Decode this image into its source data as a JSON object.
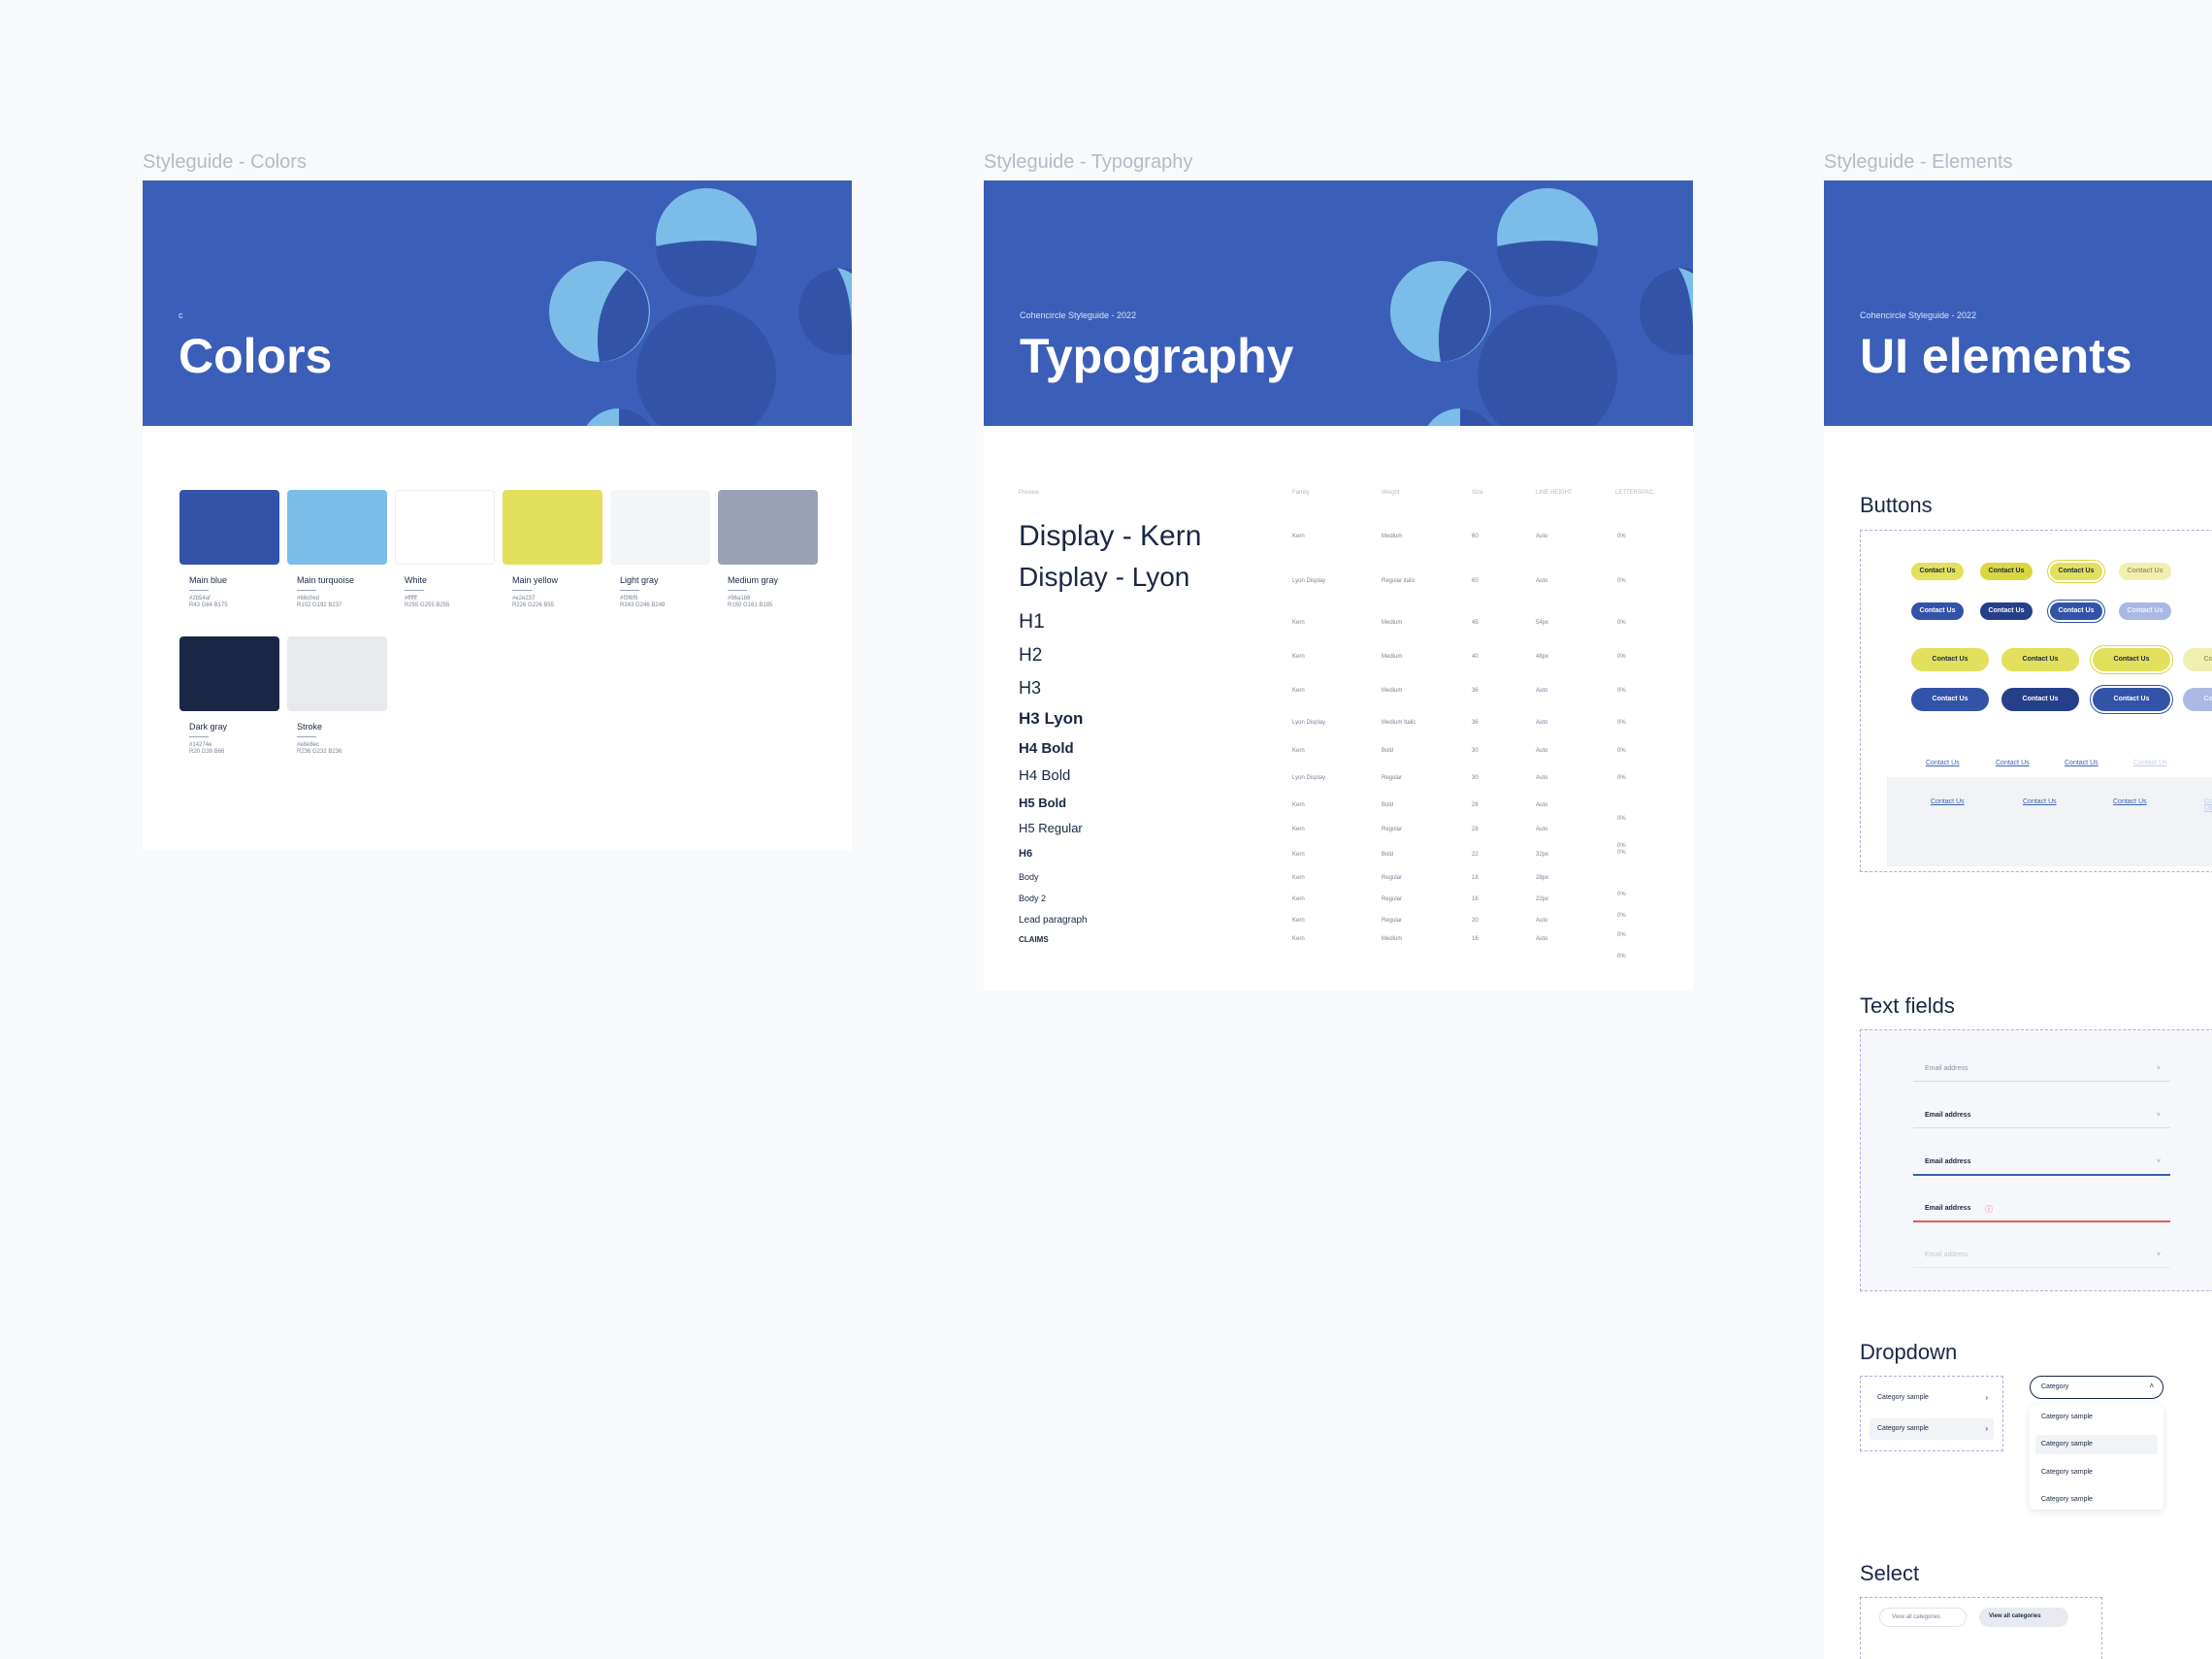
{
  "frames": {
    "colors_label": "Styleguide - Colors",
    "typography_label": "Styleguide - Typography",
    "elements_label": "Styleguide - Elements"
  },
  "colors": {
    "hero_sub": "c",
    "hero_title": "Colors",
    "swatches": [
      {
        "name": "Main blue",
        "hex": "#2b54af",
        "rgb": "R43 G84 B175",
        "color": "#3353a8"
      },
      {
        "name": "Main turquoise",
        "hex": "#66c0ed",
        "rgb": "R102 G192 B237",
        "color": "#7bbde8"
      },
      {
        "name": "White",
        "hex": "#ffffff",
        "rgb": "R255 G255 B255",
        "color": "#ffffff"
      },
      {
        "name": "Main yellow",
        "hex": "#e2e237",
        "rgb": "R226 G226 B55",
        "color": "#e2e05c"
      },
      {
        "name": "Light gray",
        "hex": "#f3f6f9",
        "rgb": "R243 G246 B249",
        "color": "#f3f5f8"
      },
      {
        "name": "Medium gray",
        "hex": "#96a1b8",
        "rgb": "R150 G161 B185",
        "color": "#9aa2b8"
      },
      {
        "name": "Dark gray",
        "hex": "#14274e",
        "rgb": "R20 G39 B66",
        "color": "#1a2744"
      },
      {
        "name": "Stroke",
        "hex": "#e8e8ec",
        "rgb": "R236 G232 B236",
        "color": "#e8e9ec"
      }
    ]
  },
  "typography": {
    "hero_sub": "Cohencircle Styleguide - 2022",
    "hero_title": "Typography",
    "headers": {
      "preview": "Preview",
      "family": "Family",
      "weight": "Weight",
      "size": "Size",
      "line_height": "LINE HEIGHT",
      "letter_spacing": "LETTERSPAC."
    },
    "rows": [
      {
        "preview": "Display - Kern",
        "family": "Kern",
        "weight": "Medium",
        "size": "60",
        "lh": "Auto",
        "ls": "0%"
      },
      {
        "preview": "Display - Lyon",
        "family": "Lyon Display",
        "weight": "Regular italic",
        "size": "60",
        "lh": "Auto",
        "ls": "0%"
      },
      {
        "preview": "H1",
        "family": "Kern",
        "weight": "Medium",
        "size": "45",
        "lh": "54px",
        "ls": "0%"
      },
      {
        "preview": "H2",
        "family": "Kern",
        "weight": "Medium",
        "size": "40",
        "lh": "48px",
        "ls": "0%"
      },
      {
        "preview": "H3",
        "family": "Kern",
        "weight": "Medium",
        "size": "36",
        "lh": "Auto",
        "ls": "0%"
      },
      {
        "preview": "H3 Lyon",
        "family": "Lyon Display",
        "weight": "Medium Italic",
        "size": "36",
        "lh": "Auto",
        "ls": "0%"
      },
      {
        "preview": "H4 Bold",
        "family": "Kern",
        "weight": "Bold",
        "size": "30",
        "lh": "Auto",
        "ls": "0%"
      },
      {
        "preview": "H4 Bold",
        "family": "Lyon Display",
        "weight": "Regular",
        "size": "30",
        "lh": "Auto",
        "ls": "0%"
      },
      {
        "preview": "H5 Bold",
        "family": "Kern",
        "weight": "Bold",
        "size": "28",
        "lh": "Auto",
        "ls": ""
      },
      {
        "preview": "H5 Regular",
        "family": "Kern",
        "weight": "Regular",
        "size": "28",
        "lh": "Auto",
        "ls": ""
      },
      {
        "preview": "H6",
        "family": "Kern",
        "weight": "Bold",
        "size": "22",
        "lh": "32px",
        "ls": ""
      },
      {
        "preview": "Body",
        "family": "Kern",
        "weight": "Regular",
        "size": "18",
        "lh": "28px",
        "ls": ""
      },
      {
        "preview": "Body 2",
        "family": "Kern",
        "weight": "Regular",
        "size": "16",
        "lh": "22px",
        "ls": ""
      },
      {
        "preview": "Lead paragraph",
        "family": "Kern",
        "weight": "Regular",
        "size": "20",
        "lh": "Auto",
        "ls": ""
      },
      {
        "preview": "CLAIMS",
        "family": "Kern",
        "weight": "Medium",
        "size": "16",
        "lh": "Auto",
        "ls": ""
      }
    ],
    "extra_pct": [
      "0%",
      "0%",
      "0%",
      "0%",
      "0%",
      "0%",
      "0%"
    ]
  },
  "elements": {
    "hero_sub": "Cohencircle Styleguide - 2022",
    "hero_title": "UI elements",
    "buttons_title": "Buttons",
    "button_label": "Contact Us",
    "textfields_title": "Text fields",
    "textfields": [
      "Email address",
      "Email address",
      "Email address",
      "Email address",
      "Email address"
    ],
    "dropdown_title": "Dropdown",
    "dropdown_items": [
      "Category sample",
      "Category sample"
    ],
    "dropdown_open_label": "Category",
    "dropdown_options": [
      "Category sample",
      "Category sample",
      "Category sample",
      "Category sample"
    ],
    "select_title": "Select",
    "select_options": [
      "View all categories",
      "View all categories"
    ]
  }
}
